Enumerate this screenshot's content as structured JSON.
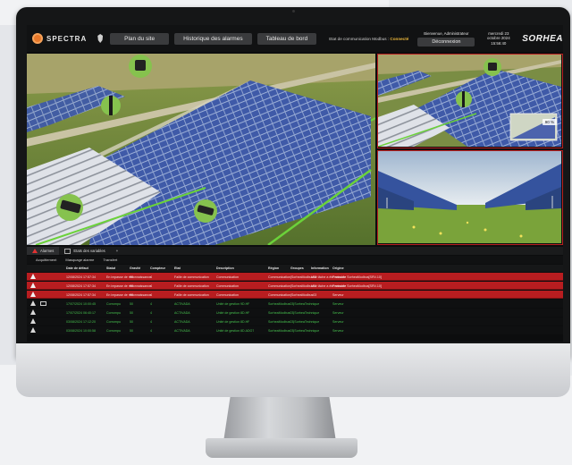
{
  "header": {
    "logo_text": "SPECTRA",
    "nav": [
      "Plan du site",
      "Historique des alarmes",
      "Tableau de bord"
    ],
    "modbus_label": "Etat de communication Modbus :",
    "modbus_status": "Connecté",
    "welcome": "Bienvenue, Administrateur",
    "logout_label": "Déconnexion",
    "date": "mercredi 23 octobre 2024",
    "time": "15:56:40",
    "brand": "SORHEA"
  },
  "video": {
    "zoom_badge": "90 %"
  },
  "tabs": [
    {
      "label": "Alarmes",
      "icon": "warning-icon",
      "active": true
    },
    {
      "label": "Etats des variables",
      "icon": "grid-icon",
      "active": false
    },
    {
      "label": "+",
      "icon": "",
      "active": false
    }
  ],
  "toolbar": {
    "ack": "Acquittement",
    "mask": "Masquage alarme",
    "transfer": "Transfert"
  },
  "table": {
    "columns": [
      "Date de défaut",
      "Statut",
      "Gravité",
      "Compteur",
      "Etat",
      "Description",
      "Région",
      "Groupes",
      "Information",
      "Origine"
    ],
    "rows": [
      {
        "kind": "alarm",
        "date": "12/08/2024 17:57:34",
        "statut": "En impasse de reconnaissance",
        "gravite": "98",
        "compteur": "4",
        "etat": "Faille de communication",
        "description": "Communication",
        "region": "Communication|SorheaModbus03",
        "information": "Une tâche a été annulée",
        "origine": "Protocole SorheaModbus[SRV-10]"
      },
      {
        "kind": "alarm",
        "date": "12/08/2024 17:57:34",
        "statut": "En impasse de reconnaissance",
        "gravite": "98",
        "compteur": "4",
        "etat": "Faille de communication",
        "description": "Communication",
        "region": "Communication|SorheaModbus01",
        "information": "Une tâche a été annulée",
        "origine": "Protocole SorheaModbus[SRV-10]"
      },
      {
        "kind": "alarm",
        "date": "12/08/2024 17:57:34",
        "statut": "En impasse de reconnaissance",
        "gravite": "98",
        "compteur": "4",
        "etat": "Faille de communication",
        "description": "Communication",
        "region": "Communication|SorheaModbus03",
        "information": "",
        "origine": "Serveur"
      },
      {
        "kind": "normal",
        "date": "17/07/2024 10:00:45",
        "statut": "Corrompu",
        "gravite": "50",
        "compteur": "4",
        "etat": "ACTIVADA",
        "description": "Unité de gestion 9D.HF",
        "region": "SorheaModbus03|SorheaTechnique",
        "information": "",
        "origine": "Serveur"
      },
      {
        "kind": "normal",
        "date": "17/07/2024 06:40:17",
        "statut": "Corrompu",
        "gravite": "50",
        "compteur": "4",
        "etat": "ACTIVADA",
        "description": "Unité de gestion 8D.HF",
        "region": "SorheaModbus03|SorheaTechnique",
        "information": "",
        "origine": "Serveur"
      },
      {
        "kind": "normal",
        "date": "03/08/2024 17:12:20",
        "statut": "Corrompu",
        "gravite": "50",
        "compteur": "4",
        "etat": "ACTIVADA",
        "description": "Unité de gestion 8D.HF",
        "region": "SorheaModbus03|SorheaTechnique",
        "information": "",
        "origine": "Serveur"
      },
      {
        "kind": "normal",
        "date": "03/08/2024 10:00:58",
        "statut": "Corrompu",
        "gravite": "50",
        "compteur": "4",
        "etat": "ACTIVADA",
        "description": "Unité de gestion 8D.ADO7",
        "region": "SorheaModbus03|SorheaTechnique",
        "information": "",
        "origine": "Serveur"
      }
    ]
  },
  "colors": {
    "alarm_row": "#b81d20",
    "normal_text": "#47c24f",
    "accent": "#e8782a"
  }
}
